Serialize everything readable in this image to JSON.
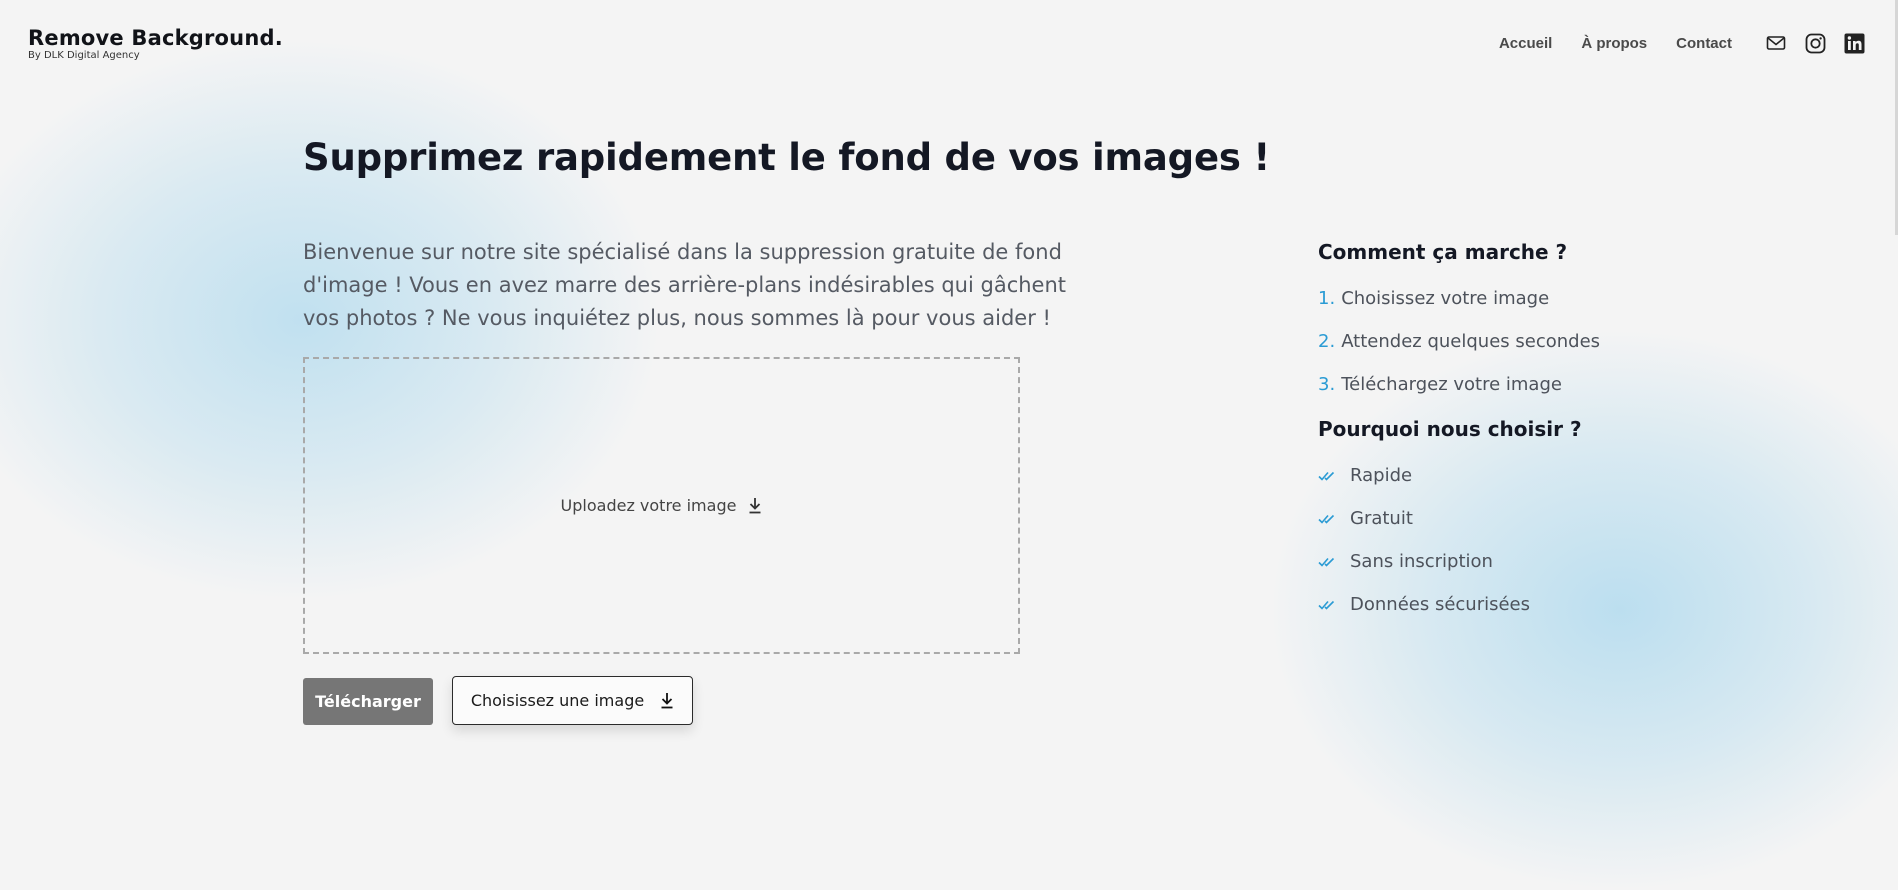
{
  "header": {
    "logo_title": "Remove Background.",
    "logo_subtitle": "By DLK Digital Agency",
    "nav": [
      {
        "label": "Accueil"
      },
      {
        "label": "À propos"
      },
      {
        "label": "Contact"
      }
    ],
    "social_icons": [
      "mail-icon",
      "instagram-icon",
      "linkedin-icon"
    ]
  },
  "main": {
    "title": "Supprimez rapidement le fond de vos images !",
    "intro": "Bienvenue sur notre site spécialisé dans la suppression gratuite de fond d'image ! Vous en avez marre des arrière-plans indésirables qui gâchent vos photos ? Ne vous inquiétez plus, nous sommes là pour vous aider !",
    "dropzone_label": "Uploadez votre image",
    "download_button": "Télécharger",
    "choose_button": "Choisissez une image"
  },
  "sidebar": {
    "how_title": "Comment ça marche ?",
    "steps": [
      {
        "num": "1.",
        "label": "Choisissez votre image"
      },
      {
        "num": "2.",
        "label": "Attendez quelques secondes"
      },
      {
        "num": "3.",
        "label": "Téléchargez votre image"
      }
    ],
    "why_title": "Pourquoi nous choisir ?",
    "benefits": [
      {
        "label": "Rapide"
      },
      {
        "label": "Gratuit"
      },
      {
        "label": "Sans inscription"
      },
      {
        "label": "Données sécurisées"
      }
    ]
  },
  "colors": {
    "accent": "#2a9bd4",
    "background": "#f4f4f4",
    "download_button_bg": "#767676",
    "glow": "#96d0ec"
  }
}
